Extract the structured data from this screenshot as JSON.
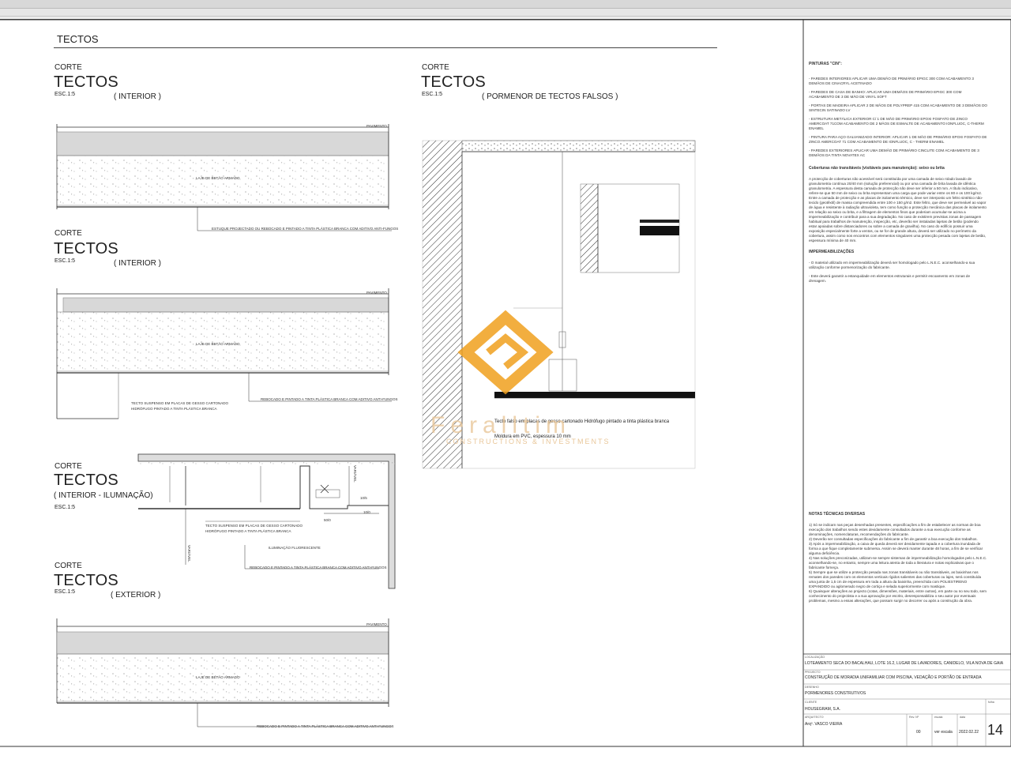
{
  "sheet": {
    "title": "TECTOS"
  },
  "sections": [
    {
      "label": "CORTE",
      "title": "TECTOS",
      "scale": "ESC.1:5",
      "subtitle": "( INTERIOR )"
    },
    {
      "label": "CORTE",
      "title": "TECTOS",
      "scale": "ESC.1:5",
      "subtitle": "( INTERIOR )"
    },
    {
      "label": "CORTE",
      "title": "TECTOS",
      "scale": "ESC.1:5",
      "subtitle": "( INTERIOR - ILUMNAÇÃO)"
    },
    {
      "label": "CORTE",
      "title": "TECTOS",
      "scale": "ESC.1:5",
      "subtitle": "( EXTERIOR )"
    },
    {
      "label": "CORTE",
      "title": "TECTOS",
      "scale": "ESC.1:5",
      "subtitle": "( PORMENOR DE TECTOS FALSOS )"
    }
  ],
  "annotations": {
    "pavimento": "PAVIMENTO",
    "laje": "LAJE DE BETÃO ARMADO",
    "estuque": "ESTUQUE PROJECTADO OU REBOCADO E PINTADO A TINTA PLÁSTICA BRANCA COM ADITIVO ANTI-FUNGOS",
    "rebocado_1": "REBOCADO E PINTADO A TINTA PLÁSTICA BRANCA COM ADITIVO ANTI-FUNGOS",
    "tecto_susp_1": "TECTO SUSPENSO EM PLACAS DE GESSO CARTONADO",
    "tecto_susp_2": "HIDRÓFUGO PINTADO A TINTA PLÁSTICA BRANCA",
    "iluminacao": "ILUMINAÇÃO FLUORESCENTE",
    "rebocado_2": "REBOCADO E PINTADO A TINTA PLÁSTICA BRANCA COM ADITIVO ANTI-FUNGOS",
    "rebocado_3": "REBOCADO E PINTADO A TINTA PLÁSTICA BRANCA COM ADITIVO ANTI-FUNGOS",
    "variavel": "VARIÁVEL",
    "detail_gesso": "Tecto falso em placas de gesso cartonado Hidrófugo pintado a tinta plástica branca",
    "detail_pvc": "Moldura em PVC, espessura 10 mm",
    "dim_1": "50/0",
    "dim_2": "10/5",
    "dim_3": "10/0"
  },
  "watermark": {
    "name": "Feralltim",
    "tagline": "CONSTRUCTIONS & INVESTMENTS",
    "color": "#f0a01e"
  },
  "notes": {
    "pinturas_title": "PINTURAS \"CIN\":",
    "pinturas": [
      "- PAREDES INTERIORES APLICAR UMA DEMÃO DE PRIMÁRIO EPIGC 300 COM ACABAMENTO 3 DEMÃOS DE CINACRYL ACETINADO",
      "- PAREDES DE CASA DE BANHO: APLICAR UMA DEMÃOS DE PRIMÁRIO EPIGC 300 COM ACABAMENTO DE 3 DE MÃO DE VINYL SOFT",
      "- PORTAS DE MADEIRA APLICAR 2 DE MÃOS DE POLYPREP 415 COM ACABAMENTO DE 3 DEMÃOS DO SINTECIN SATINADO LV",
      "- ESTRUTURA METÁLICA EXTERIOR C/ 1 DE MÃO DE PRIMÁRIO EPOXI FOSFATO DE ZINCO AMERCOAT 71COM ACABAMENTO DE 2 MÃOS DE ESMALTE DE ACABAMENTO IONFLUOC, C-THERM ENAMEL",
      "- PINTURA PARA AÇO GALVANIZADO INTERIOR: APLICAR 1 DE MÃO DE PRIMÁRIO EPOXI FOSFATO DE ZINCO AMERCOAT 71 COM ACABAMENTO DE IONFLUOC, C - THERM ENAMEL",
      "- PAREDES EXTERIORES APLICAR UMA DEMÃO DE PRIMÁRIO CINCLITE COM ACABAMENTO DE 3 DEMÃOS DA TINTA NOVATEX AC"
    ],
    "coberturas_title": "Coberturas não transitáveis (visitáveis para manutenção): seixo ou brita",
    "coberturas_text": "A protecção de coberturas não acessível será constituída por uma camada de seixo rolado lavado de granulometria contínua 20/40 mm (solução preferencial) ou por uma camada de brita lavada de idêntica granulometria. A espessura desta camada de protecção não deve ser inferior a 50 mm. A título indicativo, refere-se que 50 mm de seixo ou brita representam uma carga que pode variar entre os 80 e os 100 kg/m2. Entre a camada de protecção e as placas de isolamento térmico, deve ser interposto um feltro sintético não-tecido (geotêxtil) de massa compreendida entre 100 e 150 g/m2. Este feltro, que deve ser permeável ao vapor de água e resistente à radiação ultravioleta, tem como função a protecção mecânica das placas de isolamento em relação ao seixo ou brita, e a filtragem de elementos finos que poderiam acumular-se acima a impermeabilização e contribuir para a sua degradação. No caso de existirem previstas zonas de passagem habitual para trabalhos de manutenção, inspecção, etc, deverão ser instaladas lajetas de betão (podendo estar apoiadas sobre distanciadores ou sobre a camada de gravilha). No caso do edifício possuir uma exposição especialmente forte a ventos, ou se for de grande altura, deverá ser utilizado no perímetro da cobertura, assim como nos encontros com elementos singulares uma protecção pesada com lajetas de betão, espessura mínima de 40 mm.",
    "impermeab_title": "IMPERMEABILIZAÇÕES",
    "impermeab": [
      "- O material utilizado em impermeabilização deverá ser homologado pelo L.N.E.C. aconselhando-a sua utilização conforme pormenorização do fabricante.",
      "- Este deverá garantir a estanquidade em elementos estruturais e permitir escoamento em zonas de drenagem."
    ],
    "tecnicas_title": "NOTAS TÉCNICAS DIVERSAS",
    "tecnicas": [
      "1) Só se indicam nas peças desenhadas presentes, especificações a fim de estabelecer as normas de boa execução dos trabalhos sendo estes devidamente consultados durante a sua execução conforme as denominações, nomenclaturas, recomendações do fabricante.",
      "2) Deverão ser consultadas especificações do fabricante a fim de garantir a boa execução dos trabalhos.",
      "3) Após a impermeabilização, a caixa de queda deverá ser devidamente tapada e a cobertura inundada de forma a que fique completamente submersa. Assim se deverá manter durante 48 horas, a fim de se verificar alguma deficiência.",
      "4) Nas soluções preconizadas, utilizam-se sempre sistemas de impermeabilização homologados pelo L.N.E.C. aconselhando-se, no entanto, sempre uma leitura atenta de toda a literatura e notas explicativas que o fabricante forneça.",
      "5) Sempre que se utilize a protecção pesada nas zonas transitáveis ou não transitáveis, as baixinhas nos remates dos paredes com os elementos verticais rígidos salientes das coberturas ou lajes, será constituída uma junta de 1,5 cm de espessura em toda a altura da baixinha, preenchida com POLIESTIRENO EXPANDIDO ou aglomerado negro de cortiça e selada superiormente com mastique.",
      "6) Quaisquer alterações ao projecto (cotas, dimensões, materiais, entre outras), em parte ou no seu todo, sem conhecimento do projectista e a sua aprovação por escrito, desresponsabiliza o seu autor por eventuais problemas, mesmo a essas alterações, que possam surgir no decorrer ou após a construção da obra."
    ]
  },
  "titleblock": {
    "location_label": "LOCALIZAÇÃO",
    "location": "LOTEAMENTO SECA DO BACALHAU, LOTE 16.2, LUGAR DE LAVADORES, CANIDELO, VILA NOVA DE GAIA",
    "project_label": "PROJECTO",
    "project": "CONSTRUÇÃO DE MORADIA UNIFAMILIAR COM PISCINA, VEDAÇÃO E PORTÃO DE ENTRADA",
    "drawing_label": "DESENHO",
    "drawing": "PORMENORES CONSTRUTIVOS",
    "client_label": "CLIENTE",
    "client": "HOUSEGRAM, S.A.",
    "arch_label": "ARQUITECTO",
    "arch": "Arqº. VASCO VIEIRA",
    "rev_label": "Rev. Nº",
    "rev": "00",
    "scale_label": "escala",
    "scale": "ver escala",
    "date_label": "data",
    "date": "2022.02.22",
    "sheet_label": "folha",
    "sheet_no": "14"
  }
}
